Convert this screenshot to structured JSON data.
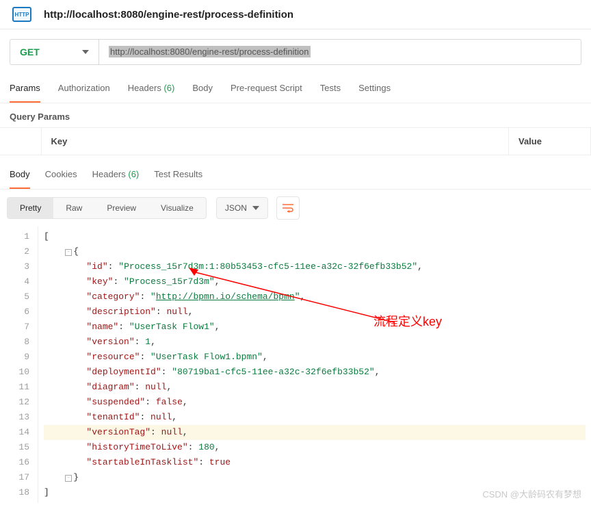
{
  "header": {
    "badge_text": "HTTP",
    "title_url": "http://localhost:8080/engine-rest/process-definition"
  },
  "request": {
    "method": "GET",
    "url": "http://localhost:8080/engine-rest/process-definition"
  },
  "tabs": [
    {
      "label": "Params",
      "active": true
    },
    {
      "label": "Authorization"
    },
    {
      "label": "Headers",
      "count": "(6)"
    },
    {
      "label": "Body"
    },
    {
      "label": "Pre-request Script"
    },
    {
      "label": "Tests"
    },
    {
      "label": "Settings"
    }
  ],
  "params": {
    "section_label": "Query Params",
    "col_key": "Key",
    "col_value": "Value"
  },
  "resp_tabs": [
    {
      "label": "Body",
      "active": true
    },
    {
      "label": "Cookies"
    },
    {
      "label": "Headers",
      "count": "(6)"
    },
    {
      "label": "Test Results"
    }
  ],
  "resp_views": [
    "Pretty",
    "Raw",
    "Preview",
    "Visualize"
  ],
  "resp_format": "JSON",
  "json": {
    "id": "Process_15r7d3m:1:80b53453-cfc5-11ee-a32c-32f6efb33b52",
    "key": "Process_15r7d3m",
    "category": "http://bpmn.io/schema/bpmn",
    "description": "null",
    "name": "UserTask Flow1",
    "version": "1",
    "resource": "UserTask Flow1.bpmn",
    "deploymentId": "80719ba1-cfc5-11ee-a32c-32f6efb33b52",
    "diagram": "null",
    "suspended": "false",
    "tenantId": "null",
    "versionTag": "null",
    "historyTimeToLive": "180",
    "startableInTasklist": "true"
  },
  "line_nums": [
    "1",
    "2",
    "3",
    "4",
    "5",
    "6",
    "7",
    "8",
    "9",
    "10",
    "11",
    "12",
    "13",
    "14",
    "15",
    "16",
    "17",
    "18"
  ],
  "annotation": {
    "text": "流程定义key"
  },
  "watermark": "CSDN @大龄码农有梦想"
}
